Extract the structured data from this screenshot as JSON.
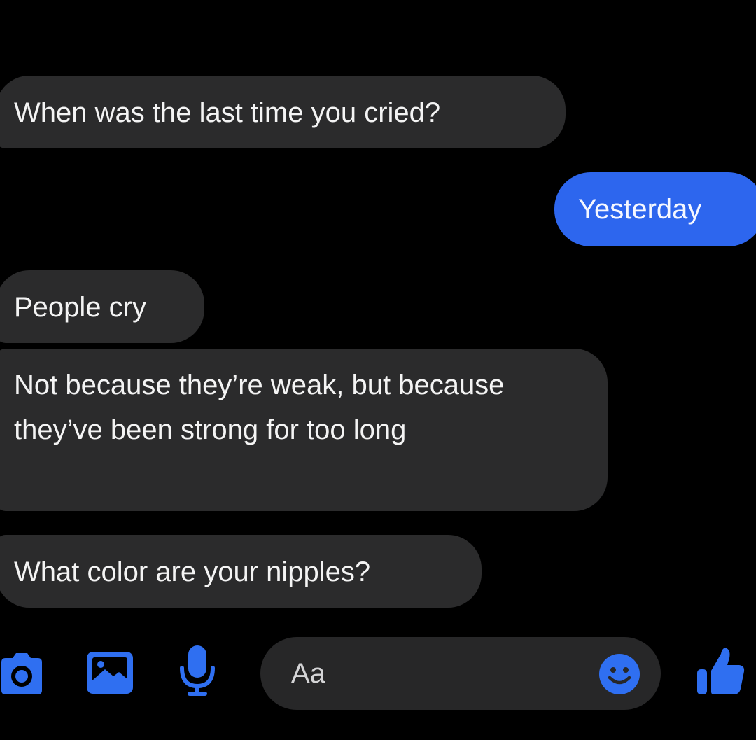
{
  "messages": [
    {
      "id": "msg1",
      "direction": "incoming",
      "text": "When was the last time you cried?"
    },
    {
      "id": "msg2",
      "direction": "outgoing",
      "text": "Yesterday"
    },
    {
      "id": "msg3",
      "direction": "incoming",
      "text": "People cry"
    },
    {
      "id": "msg4",
      "direction": "incoming",
      "text": "Not because they’re weak, but because they’ve been strong for too long"
    },
    {
      "id": "msg5",
      "direction": "incoming",
      "text": "What color are your nipples?"
    }
  ],
  "composer": {
    "placeholder": "Aa",
    "value": "",
    "icons": [
      "camera-icon",
      "image-icon",
      "microphone-icon",
      "emoji-icon",
      "thumbs-up-icon"
    ]
  },
  "colors": {
    "background": "#000000",
    "incoming_bubble": "#2b2b2c",
    "outgoing_bubble": "#2d66ee",
    "accent": "#2d6df0"
  }
}
